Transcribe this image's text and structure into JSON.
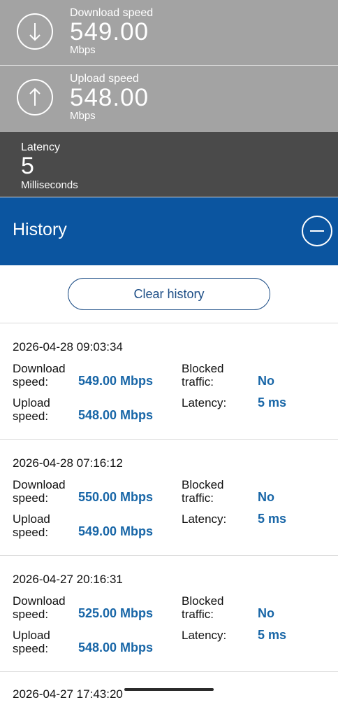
{
  "download": {
    "label": "Download speed",
    "value": "549.00",
    "unit": "Mbps"
  },
  "upload": {
    "label": "Upload speed",
    "value": "548.00",
    "unit": "Mbps"
  },
  "latency": {
    "label": "Latency",
    "value": "5",
    "unit": "Milliseconds"
  },
  "history": {
    "title": "History",
    "clear_label": "Clear history"
  },
  "entries": [
    {
      "timestamp": "2026-04-28 09:03:34",
      "dl_label": "Download speed:",
      "dl_value": "549.00 Mbps",
      "ul_label": "Upload speed:",
      "ul_value": "548.00 Mbps",
      "blocked_label": "Blocked traffic:",
      "blocked_value": "No",
      "latency_label": "Latency:",
      "latency_value": "5 ms"
    },
    {
      "timestamp": "2026-04-28 07:16:12",
      "dl_label": "Download speed:",
      "dl_value": "550.00 Mbps",
      "ul_label": "Upload speed:",
      "ul_value": "549.00 Mbps",
      "blocked_label": "Blocked traffic:",
      "blocked_value": "No",
      "latency_label": "Latency:",
      "latency_value": "5 ms"
    },
    {
      "timestamp": "2026-04-27 20:16:31",
      "dl_label": "Download speed:",
      "dl_value": "525.00 Mbps",
      "ul_label": "Upload speed:",
      "ul_value": "548.00 Mbps",
      "blocked_label": "Blocked traffic:",
      "blocked_value": "No",
      "latency_label": "Latency:",
      "latency_value": "5 ms"
    }
  ],
  "partial_entry": {
    "timestamp": "2026-04-27 17:43:20"
  }
}
